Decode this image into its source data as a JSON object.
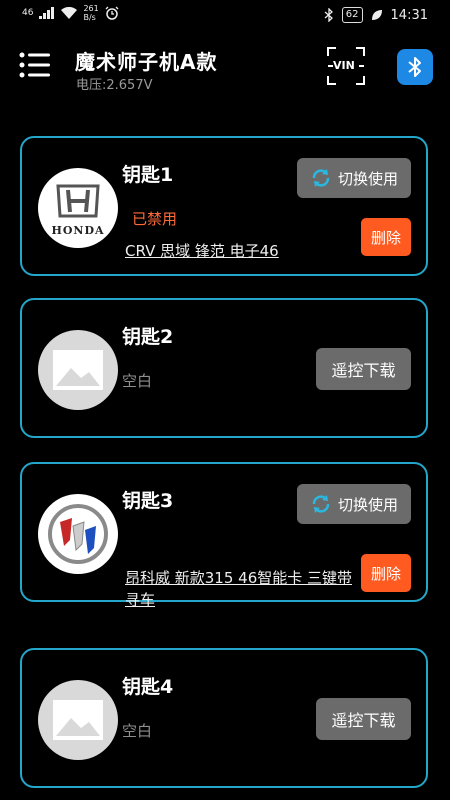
{
  "status_bar": {
    "signal": "46",
    "net_speed_value": "261",
    "net_speed_unit": "B/s",
    "battery": "62",
    "time": "14:31"
  },
  "header": {
    "title": "魔术师子机A款",
    "voltage": "电压:2.657V",
    "vin_label": "VIN"
  },
  "keys": [
    {
      "name": "钥匙1",
      "status": "已禁用",
      "model": "CRV 思域 锋范 电子46",
      "switch_label": "切换使用",
      "delete_label": "删除",
      "logo_text": "HONDA"
    },
    {
      "name": "钥匙2",
      "status": "空白",
      "download_label": "遥控下载"
    },
    {
      "name": "钥匙3",
      "model": "昂科威 新款315 46智能卡 三键带寻车",
      "switch_label": "切换使用",
      "delete_label": "删除"
    },
    {
      "name": "钥匙4",
      "status": "空白",
      "download_label": "遥控下载"
    }
  ],
  "colors": {
    "card_border": "#23a6c9",
    "button_gray": "#6b6b6b",
    "delete_orange": "#ff5a1f",
    "disabled_text": "#ff6a3a",
    "bluetooth_blue": "#1e88e5"
  }
}
